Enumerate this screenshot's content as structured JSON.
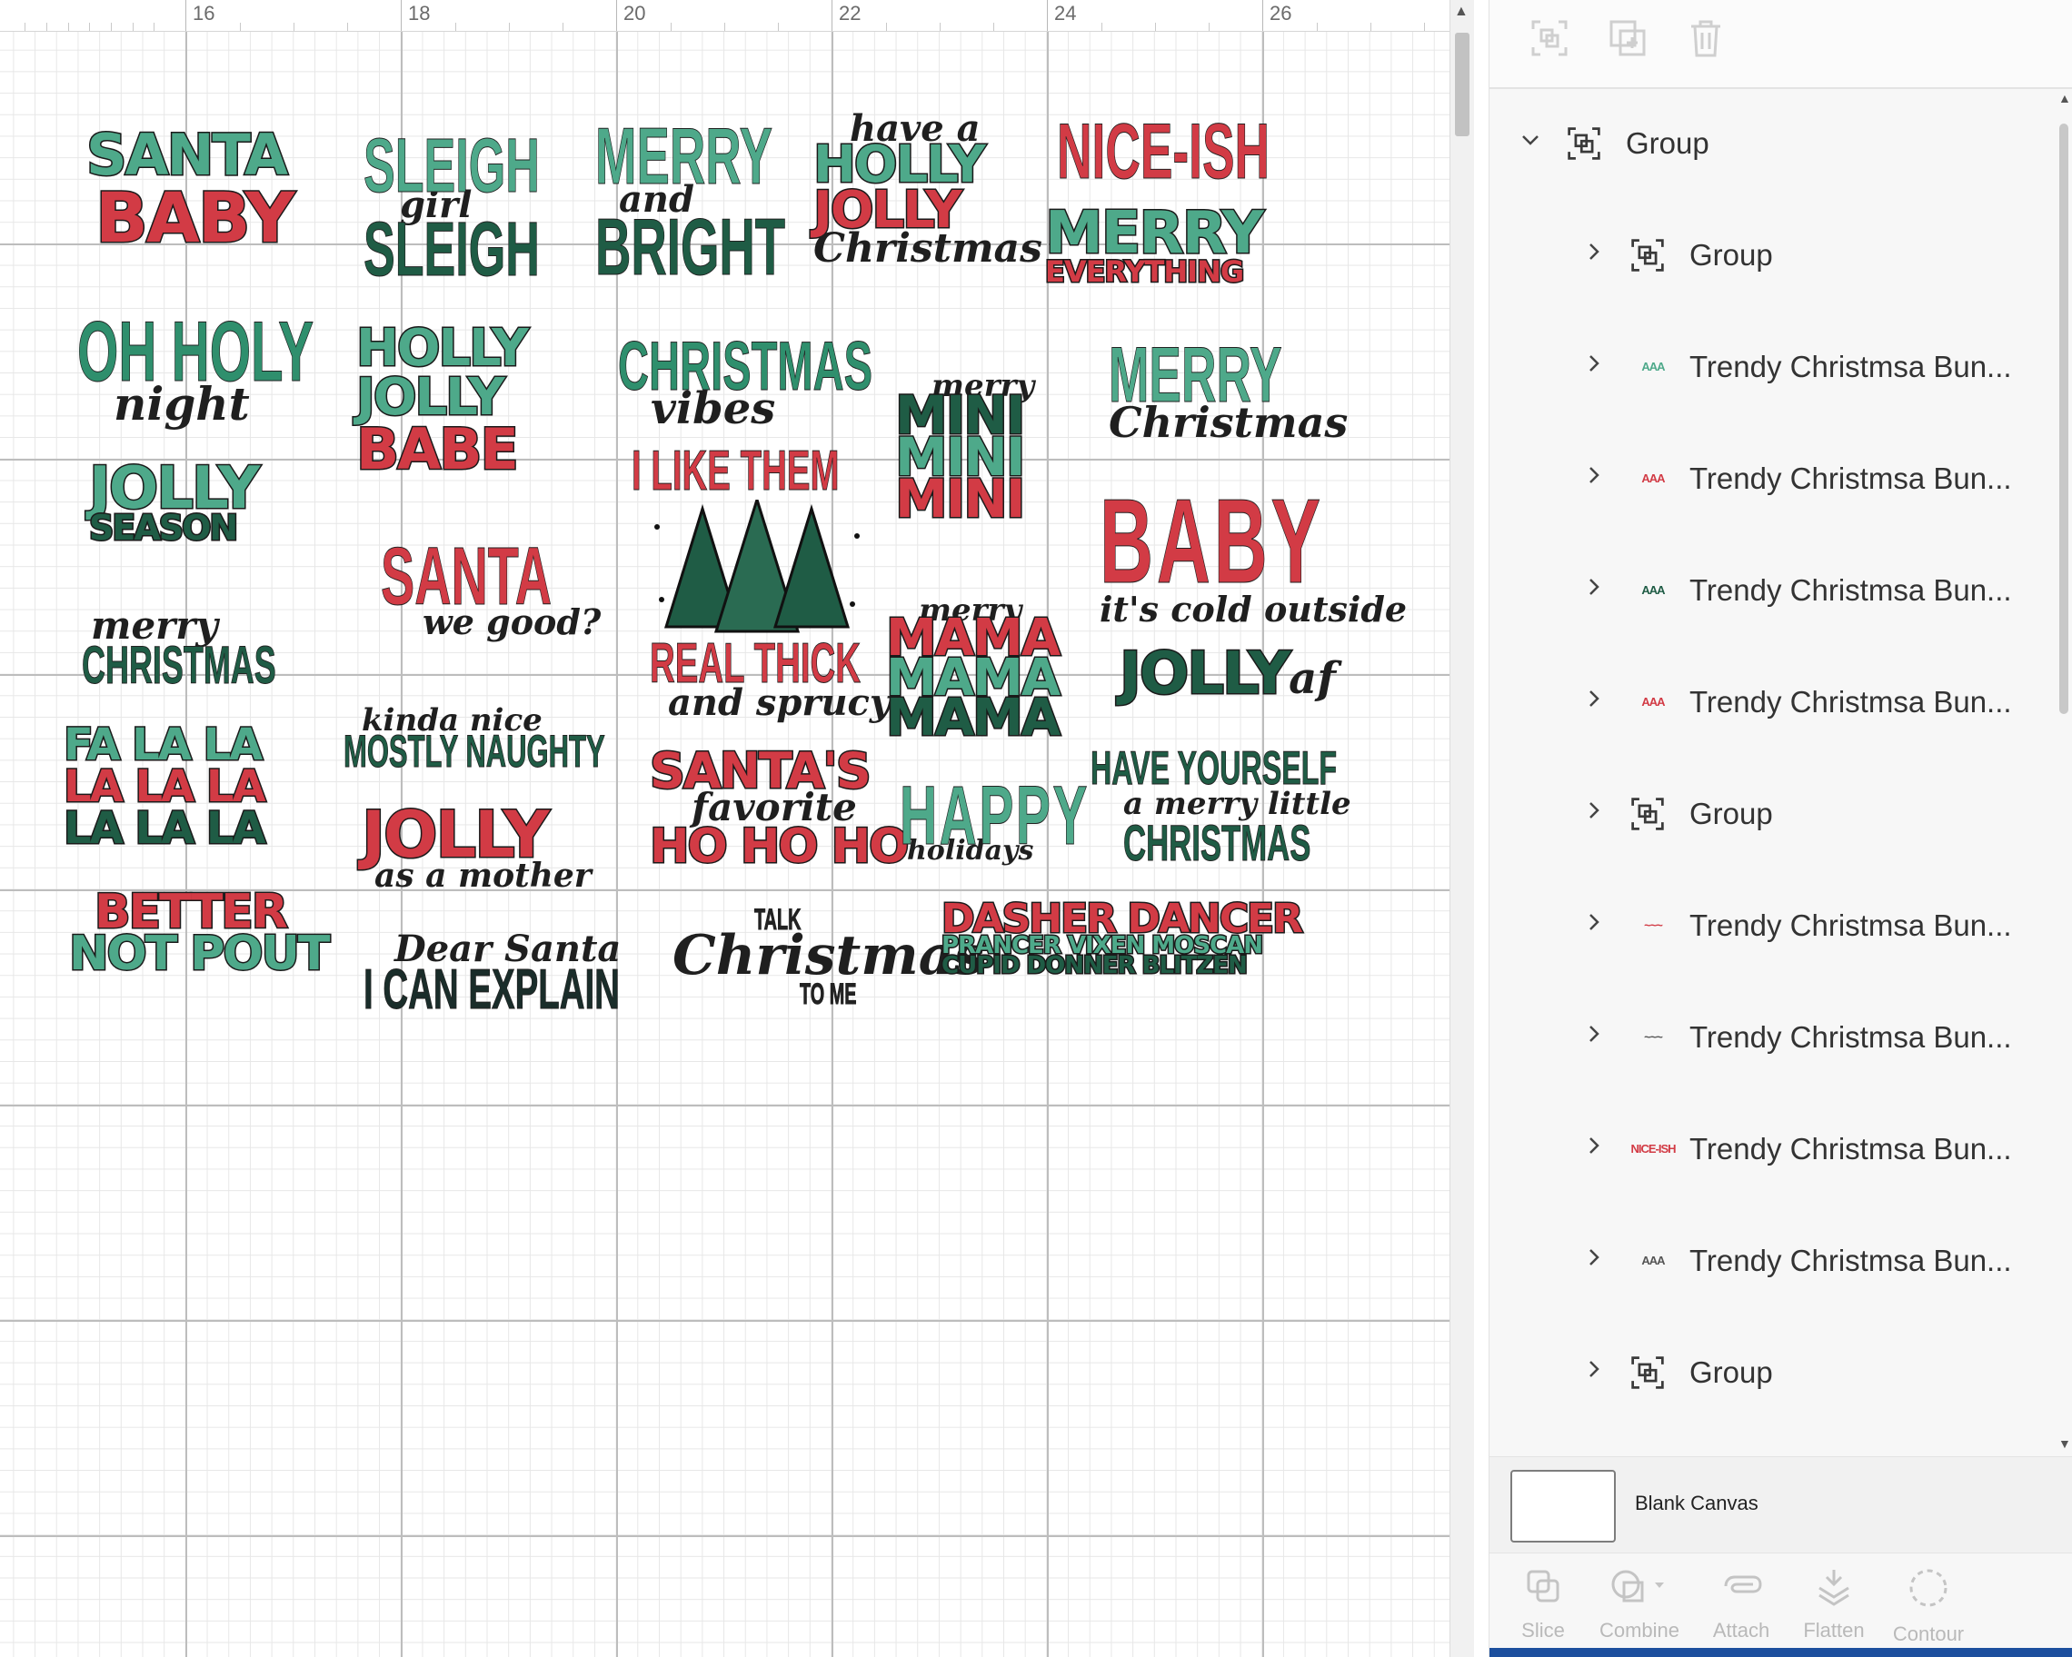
{
  "ruler": {
    "ticks": [
      "16",
      "18",
      "20",
      "22",
      "24",
      "26"
    ]
  },
  "designs": [
    {
      "l1": "SANTA",
      "l2": "BABY"
    },
    {
      "l1": "SLEIGH",
      "l2": "girl",
      "l3": "SLEIGH"
    },
    {
      "l1": "MERRY",
      "l2": "and",
      "l3": "BRIGHT"
    },
    {
      "l1": "have a",
      "l2": "HOLLY",
      "l3": "JOLLY",
      "l4": "Christmas"
    },
    {
      "l1": "NICE-ISH"
    },
    {
      "l1": "MERRY",
      "l2": "EVERYTHING"
    },
    {
      "l1": "OH HOLY",
      "l2": "night"
    },
    {
      "l1": "HOLLY",
      "l2": "JOLLY",
      "l3": "BABE"
    },
    {
      "l1": "CHRISTMAS",
      "l2": "vibes"
    },
    {
      "l1": "merry",
      "l2": "MINI",
      "l3": "MINI",
      "l4": "MINI"
    },
    {
      "l1": "MERRY",
      "l2": "Christmas"
    },
    {
      "l1": "JOLLY",
      "l2": "SEASON"
    },
    {
      "l1": "SANTA",
      "l2": "we good?"
    },
    {
      "l1": "I LIKE THEM",
      "l2": "REAL THICK",
      "l3": "and sprucy"
    },
    {
      "l1": "BABY",
      "l2": "it's cold outside"
    },
    {
      "l1": "merry",
      "l2": "CHRISTMAS"
    },
    {
      "l1": "merry",
      "l2": "MAMA",
      "l3": "MAMA",
      "l4": "MAMA"
    },
    {
      "l1": "JOLLY",
      "l2": "af"
    },
    {
      "l1": "FA LA LA",
      "l2": "LA LA LA",
      "l3": "LA LA LA"
    },
    {
      "l1": "kinda nice",
      "l2": "MOSTLY NAUGHTY"
    },
    {
      "l1": "SANTA'S",
      "l2": "favorite",
      "l3": "HO HO HO"
    },
    {
      "l1": "HAPPY",
      "l2": "holidays"
    },
    {
      "l1": "HAVE YOURSELF",
      "l2": "a merry little",
      "l3": "CHRISTMAS"
    },
    {
      "l1": "JOLLY",
      "l2": "as a mother"
    },
    {
      "l1": "BETTER",
      "l2": "NOT POUT"
    },
    {
      "l1": "Dear Santa",
      "l2": "I CAN EXPLAIN"
    },
    {
      "l1": "TALK",
      "l2": "Christmas",
      "l3": "TO ME"
    },
    {
      "l1": "DASHER DANCER",
      "l2": "PRANCER VIXEN MOSCAN",
      "l3": "CUPID DONNER BLITZEN"
    }
  ],
  "layers": [
    {
      "label": "Group",
      "type": "group",
      "expanded": true,
      "indent": 0
    },
    {
      "label": "Group",
      "type": "group",
      "indent": 1
    },
    {
      "label": "Trendy Christmsa Bun...",
      "type": "thumb",
      "thumb": "AAA",
      "thumb_color": "#4ea98a",
      "indent": 1
    },
    {
      "label": "Trendy Christmsa Bun...",
      "type": "thumb",
      "thumb": "AAA",
      "thumb_color": "#d23b45",
      "indent": 1
    },
    {
      "label": "Trendy Christmsa Bun...",
      "type": "thumb",
      "thumb": "AAA",
      "thumb_color": "#1f5c45",
      "indent": 1
    },
    {
      "label": "Trendy Christmsa Bun...",
      "type": "thumb",
      "thumb": "AAA",
      "thumb_color": "#d23b45",
      "indent": 1
    },
    {
      "label": "Group",
      "type": "group",
      "indent": 1
    },
    {
      "label": "Trendy Christmsa Bun...",
      "type": "thumb",
      "thumb": "~~~",
      "thumb_color": "#d23b45",
      "indent": 1
    },
    {
      "label": "Trendy Christmsa Bun...",
      "type": "thumb",
      "thumb": "~~~",
      "thumb_color": "#555555",
      "indent": 1
    },
    {
      "label": "Trendy Christmsa Bun...",
      "type": "thumb",
      "thumb": "NICE-ISH",
      "thumb_color": "#d23b45",
      "indent": 1
    },
    {
      "label": "Trendy Christmsa Bun...",
      "type": "thumb",
      "thumb": "AAA",
      "thumb_color": "#555555",
      "indent": 1
    },
    {
      "label": "Group",
      "type": "group",
      "indent": 1
    }
  ],
  "blank_canvas": {
    "label": "Blank Canvas"
  },
  "bottom_tools": [
    {
      "label": "Slice",
      "icon": "slice-icon"
    },
    {
      "label": "Combine",
      "icon": "combine-icon"
    },
    {
      "label": "Attach",
      "icon": "attach-icon"
    },
    {
      "label": "Flatten",
      "icon": "flatten-icon"
    },
    {
      "label": "Contour",
      "icon": "contour-icon"
    }
  ],
  "colors": {
    "red": "#d23b45",
    "green": "#4ea98a",
    "darkgreen": "#1f5c45",
    "accent": "#1c4f9e"
  }
}
